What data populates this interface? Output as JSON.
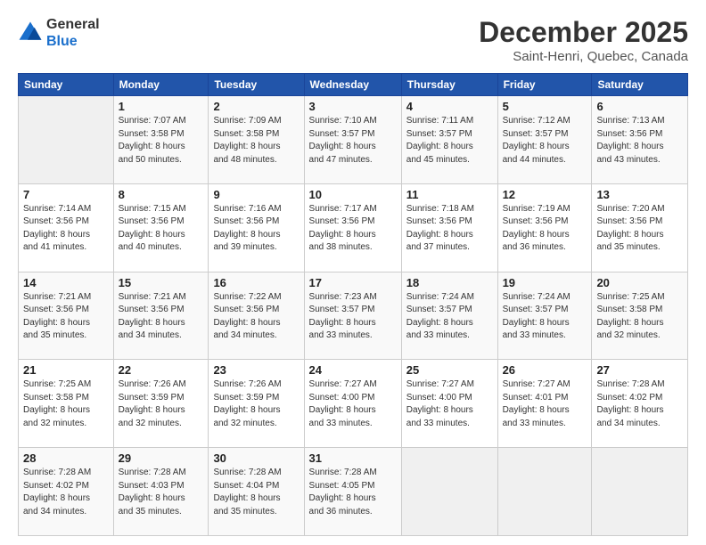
{
  "header": {
    "logo_general": "General",
    "logo_blue": "Blue",
    "month": "December 2025",
    "location": "Saint-Henri, Quebec, Canada"
  },
  "weekdays": [
    "Sunday",
    "Monday",
    "Tuesday",
    "Wednesday",
    "Thursday",
    "Friday",
    "Saturday"
  ],
  "weeks": [
    [
      {
        "day": "",
        "info": ""
      },
      {
        "day": "1",
        "info": "Sunrise: 7:07 AM\nSunset: 3:58 PM\nDaylight: 8 hours\nand 50 minutes."
      },
      {
        "day": "2",
        "info": "Sunrise: 7:09 AM\nSunset: 3:58 PM\nDaylight: 8 hours\nand 48 minutes."
      },
      {
        "day": "3",
        "info": "Sunrise: 7:10 AM\nSunset: 3:57 PM\nDaylight: 8 hours\nand 47 minutes."
      },
      {
        "day": "4",
        "info": "Sunrise: 7:11 AM\nSunset: 3:57 PM\nDaylight: 8 hours\nand 45 minutes."
      },
      {
        "day": "5",
        "info": "Sunrise: 7:12 AM\nSunset: 3:57 PM\nDaylight: 8 hours\nand 44 minutes."
      },
      {
        "day": "6",
        "info": "Sunrise: 7:13 AM\nSunset: 3:56 PM\nDaylight: 8 hours\nand 43 minutes."
      }
    ],
    [
      {
        "day": "7",
        "info": "Sunrise: 7:14 AM\nSunset: 3:56 PM\nDaylight: 8 hours\nand 41 minutes."
      },
      {
        "day": "8",
        "info": "Sunrise: 7:15 AM\nSunset: 3:56 PM\nDaylight: 8 hours\nand 40 minutes."
      },
      {
        "day": "9",
        "info": "Sunrise: 7:16 AM\nSunset: 3:56 PM\nDaylight: 8 hours\nand 39 minutes."
      },
      {
        "day": "10",
        "info": "Sunrise: 7:17 AM\nSunset: 3:56 PM\nDaylight: 8 hours\nand 38 minutes."
      },
      {
        "day": "11",
        "info": "Sunrise: 7:18 AM\nSunset: 3:56 PM\nDaylight: 8 hours\nand 37 minutes."
      },
      {
        "day": "12",
        "info": "Sunrise: 7:19 AM\nSunset: 3:56 PM\nDaylight: 8 hours\nand 36 minutes."
      },
      {
        "day": "13",
        "info": "Sunrise: 7:20 AM\nSunset: 3:56 PM\nDaylight: 8 hours\nand 35 minutes."
      }
    ],
    [
      {
        "day": "14",
        "info": "Sunrise: 7:21 AM\nSunset: 3:56 PM\nDaylight: 8 hours\nand 35 minutes."
      },
      {
        "day": "15",
        "info": "Sunrise: 7:21 AM\nSunset: 3:56 PM\nDaylight: 8 hours\nand 34 minutes."
      },
      {
        "day": "16",
        "info": "Sunrise: 7:22 AM\nSunset: 3:56 PM\nDaylight: 8 hours\nand 34 minutes."
      },
      {
        "day": "17",
        "info": "Sunrise: 7:23 AM\nSunset: 3:57 PM\nDaylight: 8 hours\nand 33 minutes."
      },
      {
        "day": "18",
        "info": "Sunrise: 7:24 AM\nSunset: 3:57 PM\nDaylight: 8 hours\nand 33 minutes."
      },
      {
        "day": "19",
        "info": "Sunrise: 7:24 AM\nSunset: 3:57 PM\nDaylight: 8 hours\nand 33 minutes."
      },
      {
        "day": "20",
        "info": "Sunrise: 7:25 AM\nSunset: 3:58 PM\nDaylight: 8 hours\nand 32 minutes."
      }
    ],
    [
      {
        "day": "21",
        "info": "Sunrise: 7:25 AM\nSunset: 3:58 PM\nDaylight: 8 hours\nand 32 minutes."
      },
      {
        "day": "22",
        "info": "Sunrise: 7:26 AM\nSunset: 3:59 PM\nDaylight: 8 hours\nand 32 minutes."
      },
      {
        "day": "23",
        "info": "Sunrise: 7:26 AM\nSunset: 3:59 PM\nDaylight: 8 hours\nand 32 minutes."
      },
      {
        "day": "24",
        "info": "Sunrise: 7:27 AM\nSunset: 4:00 PM\nDaylight: 8 hours\nand 33 minutes."
      },
      {
        "day": "25",
        "info": "Sunrise: 7:27 AM\nSunset: 4:00 PM\nDaylight: 8 hours\nand 33 minutes."
      },
      {
        "day": "26",
        "info": "Sunrise: 7:27 AM\nSunset: 4:01 PM\nDaylight: 8 hours\nand 33 minutes."
      },
      {
        "day": "27",
        "info": "Sunrise: 7:28 AM\nSunset: 4:02 PM\nDaylight: 8 hours\nand 34 minutes."
      }
    ],
    [
      {
        "day": "28",
        "info": "Sunrise: 7:28 AM\nSunset: 4:02 PM\nDaylight: 8 hours\nand 34 minutes."
      },
      {
        "day": "29",
        "info": "Sunrise: 7:28 AM\nSunset: 4:03 PM\nDaylight: 8 hours\nand 35 minutes."
      },
      {
        "day": "30",
        "info": "Sunrise: 7:28 AM\nSunset: 4:04 PM\nDaylight: 8 hours\nand 35 minutes."
      },
      {
        "day": "31",
        "info": "Sunrise: 7:28 AM\nSunset: 4:05 PM\nDaylight: 8 hours\nand 36 minutes."
      },
      {
        "day": "",
        "info": ""
      },
      {
        "day": "",
        "info": ""
      },
      {
        "day": "",
        "info": ""
      }
    ]
  ]
}
